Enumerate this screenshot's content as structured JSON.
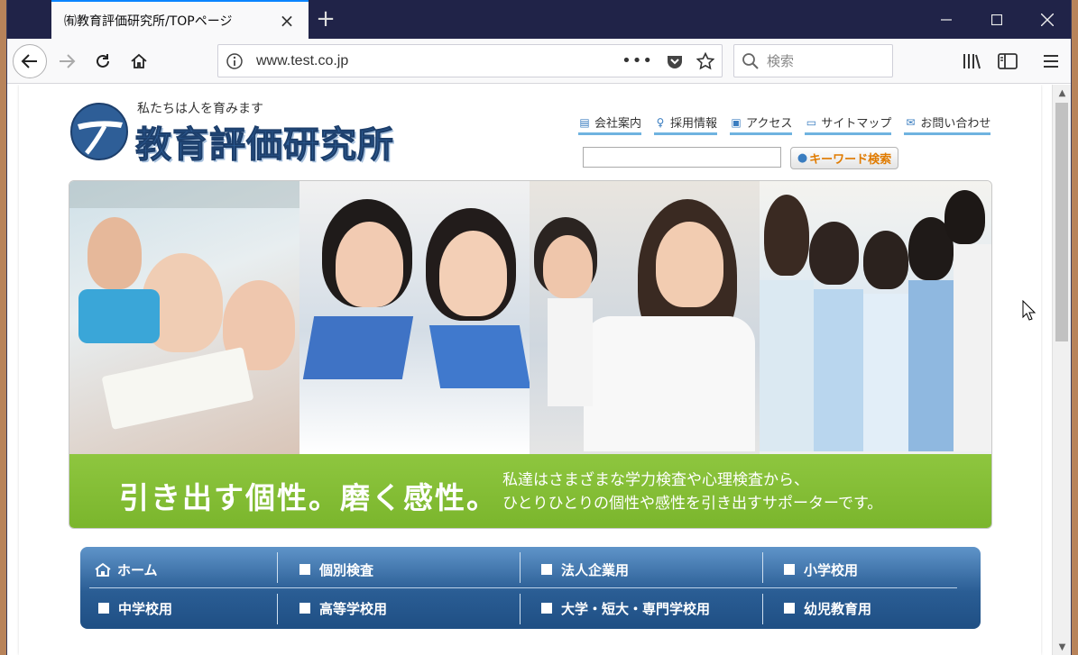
{
  "browser": {
    "tab_title": "㈲教育評価研究所/TOPページ",
    "url": "www.test.co.jp",
    "search_placeholder": "検索"
  },
  "header": {
    "tagline": "私たちは人を育みます",
    "org_name": "教育評価研究所",
    "links": [
      "会社案内",
      "採用情報",
      "アクセス",
      "サイトマップ",
      "お問い合わせ"
    ],
    "keyword_search_button": "キーワード検索"
  },
  "hero": {
    "headline": "引き出す個性。磨く感性。",
    "subtext_line1": "私達はさまざまな学力検査や心理検査から、",
    "subtext_line2": "ひとりひとりの個性や感性を引き出すサポーターです。",
    "caption_color": "#80bb31"
  },
  "global_nav": {
    "row1": [
      "ホーム",
      "個別検査",
      "法人企業用",
      "小学校用"
    ],
    "row2": [
      "中学校用",
      "高等学校用",
      "大学・短大・専門学校用",
      "幼児教育用"
    ]
  },
  "colors": {
    "accent": "#0a84ff",
    "titlebar": "#202348",
    "nav_blue": "#2a5d94"
  }
}
